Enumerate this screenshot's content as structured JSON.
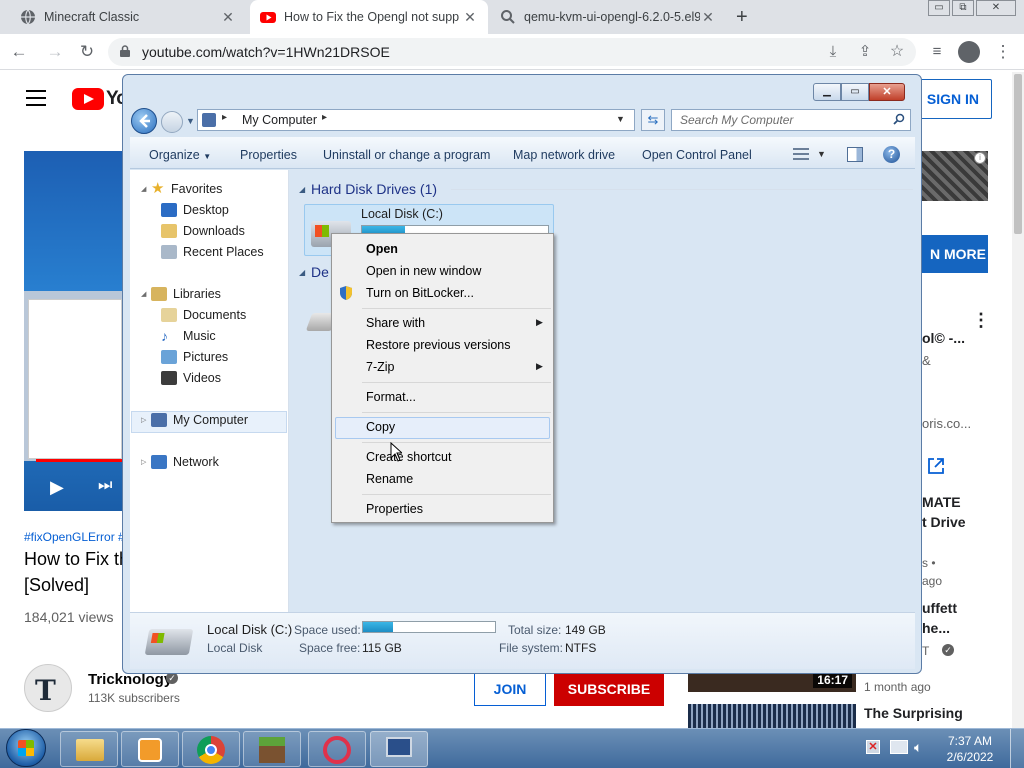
{
  "browser": {
    "tabs": [
      {
        "title": "Minecraft Classic",
        "close": "✕"
      },
      {
        "title": "How to Fix the Opengl not supp",
        "close": "✕"
      },
      {
        "title": "qemu-kvm-ui-opengl-6.2.0-5.el9",
        "close": "✕"
      }
    ],
    "new_tab": "+",
    "url": "youtube.com/watch?v=1HWn21DRSOE",
    "window_controls": {
      "minimize": "▭",
      "restore": "⧉",
      "close": "✕"
    }
  },
  "youtube": {
    "sign_in": "SIGN IN",
    "learn_more": "N MORE",
    "hashtags": "#fixOpenGLError #",
    "title_line1": "How to Fix th",
    "title_line2": "[Solved]",
    "views": "184,021 views",
    "channel_name": "Tricknology",
    "subscribers": "113K subscribers",
    "join": "JOIN",
    "subscribe": "SUBSCRIBE",
    "sidebar": {
      "item1_line1": "ol© -...",
      "item1_line2": "&",
      "item1_line3": "oris.co...",
      "item2_line1": "MATE",
      "item2_line2": "t Drive",
      "item2_line3": "s •",
      "item2_line4": "ago",
      "item3_line1": "uffett",
      "item3_line2": "he...",
      "item3_line3": "T",
      "duration": "16:17",
      "item3_age": "1 month ago",
      "item4_title": "The Surprising"
    }
  },
  "explorer": {
    "address": "My Computer",
    "search_placeholder": "Search My Computer",
    "commands": {
      "organize": "Organize",
      "properties": "Properties",
      "uninstall": "Uninstall or change a program",
      "map_drive": "Map network drive",
      "control_panel": "Open Control Panel"
    },
    "nav": {
      "favorites": "Favorites",
      "desktop": "Desktop",
      "downloads": "Downloads",
      "recent": "Recent Places",
      "libraries": "Libraries",
      "documents": "Documents",
      "music": "Music",
      "pictures": "Pictures",
      "videos": "Videos",
      "my_computer": "My Computer",
      "network": "Network"
    },
    "group_header": "Hard Disk Drives (1)",
    "group_header2": "De",
    "drive_name": "Local Disk (C:)",
    "details": {
      "name": "Local Disk (C:)",
      "type": "Local Disk",
      "space_used_label": "Space used:",
      "space_free_label": "Space free:",
      "space_free": "115 GB",
      "total_size_label": "Total size:",
      "total_size": "149 GB",
      "file_system_label": "File system:",
      "file_system": "NTFS",
      "used_fraction": 0.23
    }
  },
  "context_menu": {
    "open": "Open",
    "open_new": "Open in new window",
    "bitlocker": "Turn on BitLocker...",
    "share_with": "Share with",
    "restore": "Restore previous versions",
    "zip": "7-Zip",
    "format": "Format...",
    "copy": "Copy",
    "create_shortcut": "Create shortcut",
    "rename": "Rename",
    "properties": "Properties"
  },
  "taskbar": {
    "time": "7:37 AM",
    "date": "2/6/2022"
  },
  "colors": {
    "youtube_red": "#ff0000",
    "subscribe_red": "#cc0000",
    "link_blue": "#065fd4",
    "explorer_frame": "#d9e6f3"
  }
}
